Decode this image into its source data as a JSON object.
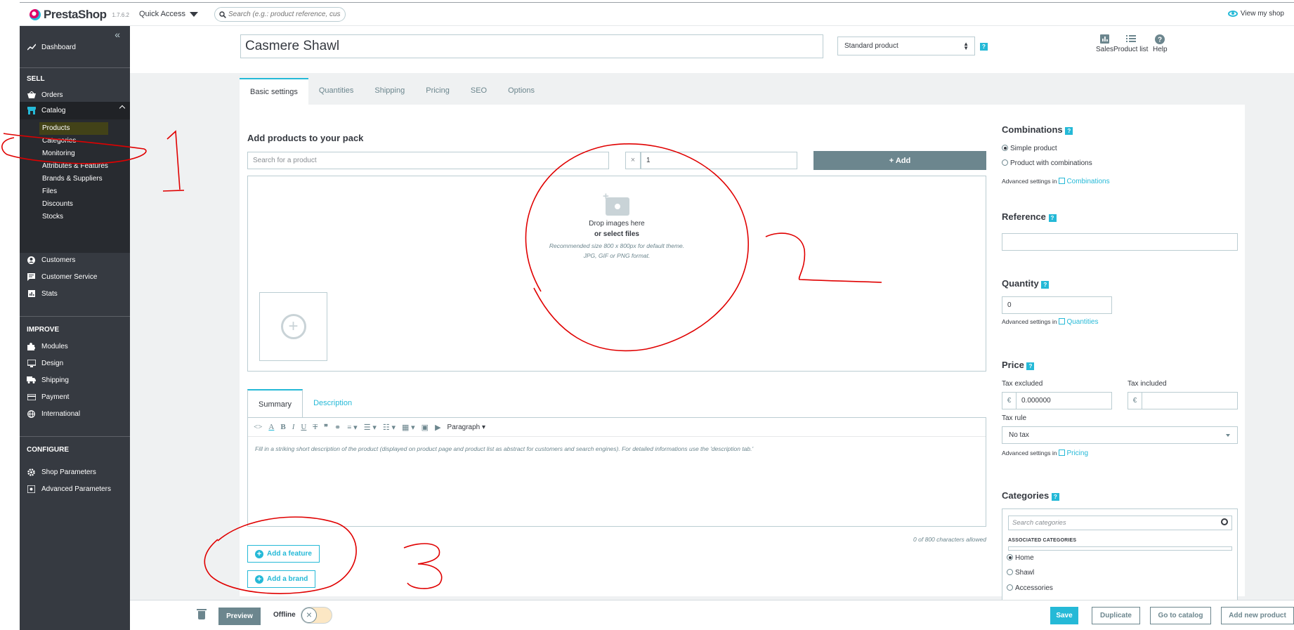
{
  "topbar": {
    "logo_name": "PrestaShop",
    "version": "1.7.6.2",
    "quick_access": "Quick Access",
    "search_placeholder": "Search (e.g.: product reference, customer name…)",
    "view_shop": "View my shop"
  },
  "sidebar": {
    "dashboard": "Dashboard",
    "sell_title": "SELL",
    "orders": "Orders",
    "catalog": "Catalog",
    "catalog_sub": [
      "Products",
      "Categories",
      "Monitoring",
      "Attributes & Features",
      "Brands & Suppliers",
      "Files",
      "Discounts",
      "Stocks"
    ],
    "customers": "Customers",
    "customer_service": "Customer Service",
    "stats": "Stats",
    "improve_title": "IMPROVE",
    "modules": "Modules",
    "design": "Design",
    "shipping": "Shipping",
    "payment": "Payment",
    "international": "International",
    "configure_title": "CONFIGURE",
    "shop_parameters": "Shop Parameters",
    "advanced_parameters": "Advanced Parameters"
  },
  "header": {
    "product_name": "Casmere Shawl",
    "product_type": "Standard product",
    "help": "?",
    "links": [
      "Sales",
      "Product list",
      "Help"
    ]
  },
  "tabs": [
    "Basic settings",
    "Quantities",
    "Shipping",
    "Pricing",
    "SEO",
    "Options"
  ],
  "pack": {
    "title": "Add products to your pack",
    "search_placeholder": "Search for a product",
    "qty_x": "×",
    "qty_value": "1",
    "add_button": "+ Add"
  },
  "dropzone": {
    "line1": "Drop images here",
    "line2": "or select files",
    "line3": "Recommended size 800 x 800px for default theme.",
    "line4": "JPG, GIF or PNG format."
  },
  "description": {
    "tabs": [
      "Summary",
      "Description"
    ],
    "paragraph": "Paragraph",
    "placeholder": "Fill in a striking short description of the product (displayed on product page and product list as abstract for customers and search engines). For detailed informations use the 'description tab.'",
    "char_count": "0 of 800 characters allowed"
  },
  "buttons": {
    "add_feature": "Add a feature",
    "add_brand": "Add a brand"
  },
  "right": {
    "combinations_title": "Combinations",
    "simple_product": "Simple product",
    "with_combinations": "Product with combinations",
    "advanced_settings_in": "Advanced settings in",
    "combinations_link": "Combinations",
    "reference_title": "Reference",
    "reference_value": "",
    "quantity_title": "Quantity",
    "quantity_value": "0",
    "quantities_link": "Quantities",
    "price_title": "Price",
    "tax_excluded": "Tax excluded",
    "tax_included": "Tax included",
    "currency": "€",
    "tax_excluded_value": "0.000000",
    "tax_included_value": "",
    "tax_rule_label": "Tax rule",
    "tax_rule_value": "No tax",
    "pricing_link": "Pricing",
    "categories_title": "Categories",
    "cat_search_placeholder": "Search categories",
    "associated_categories": "ASSOCIATED CATEGORIES",
    "categories": [
      "Home",
      "Shawl",
      "Accessories"
    ]
  },
  "bottom": {
    "preview": "Preview",
    "offline": "Offline",
    "toggle_x": "×",
    "save": "Save",
    "duplicate": "Duplicate",
    "go_to_catalog": "Go to catalog",
    "add_new_product": "Add new product"
  },
  "annotations": [
    "1",
    "2",
    "3"
  ],
  "colors": {
    "accent": "#25b9d7",
    "sidebar": "#363a41",
    "annotation": "#e00000",
    "brand_pink": "#df0067"
  }
}
